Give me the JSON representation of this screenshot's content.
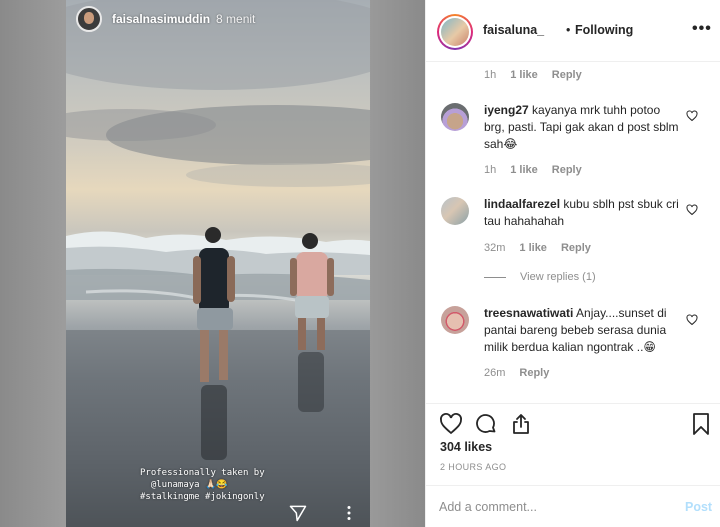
{
  "story": {
    "username": "faisalnasimuddin",
    "time": "8 menit",
    "caption": "Professionally taken by\n  @lunamaya 🙏🏻😂\n#stalkingme #jokingonly"
  },
  "post": {
    "username": "faisaluna_",
    "separator": "•",
    "follow_status": "Following"
  },
  "comments": [
    {
      "meta": {
        "time": "1h",
        "likes": "1 like",
        "reply": "Reply"
      }
    },
    {
      "username": "iyeng27",
      "text": "kayanya mrk tuhh potoo brg, pasti. Tapi gak akan d post sblm sah😂",
      "meta": {
        "time": "1h",
        "likes": "1 like",
        "reply": "Reply"
      }
    },
    {
      "username": "lindaalfarezel",
      "text": "kubu sblh pst sbuk cri tau hahahahah",
      "meta": {
        "time": "32m",
        "likes": "1 like",
        "reply": "Reply"
      },
      "view_replies": "View replies (1)"
    },
    {
      "username": "treesnawatiwati",
      "text": "Anjay....sunset di pantai bareng bebeb serasa dunia milik berdua kalian ngontrak ..😁",
      "meta": {
        "time": "26m",
        "reply": "Reply"
      }
    }
  ],
  "likes": "304 likes",
  "time_ago": "2 HOURS AGO",
  "add_comment": {
    "placeholder": "Add a comment...",
    "post_label": "Post"
  },
  "colors": {
    "link_disabled": "#b2dffc",
    "muted": "#8e8e8e",
    "text": "#262626"
  },
  "icons": [
    "send-icon",
    "more-vertical-icon",
    "more-horizontal-icon",
    "heart-icon",
    "comment-icon",
    "share-icon",
    "bookmark-icon"
  ]
}
